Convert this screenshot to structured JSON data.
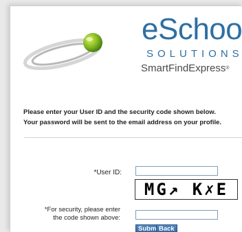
{
  "logo": {
    "brand_name": "eSchool",
    "tagline": "SOLUTIONS",
    "product_name": "SmartFindExpress",
    "trademark": "®"
  },
  "instructions": {
    "line1": "Please enter your User ID and the security code shown below.",
    "line2": "Your password will be sent to the email address on your profile."
  },
  "form": {
    "userid_label": "*User ID:",
    "userid_value": "",
    "captcha_text": "MG↗ K✗E",
    "security_label_line1": "*For security, please enter",
    "security_label_line2": "the code shown above:",
    "code_value": "",
    "submit_label": "Submit",
    "back_label": "Back"
  }
}
